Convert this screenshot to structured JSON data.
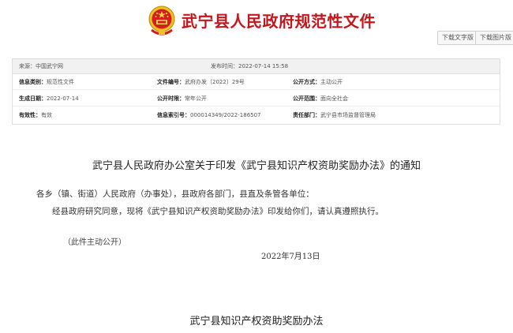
{
  "header": {
    "site_title": "武宁县人民政府规范性文件",
    "download_text": "下载文字版",
    "download_image": "下载图片版"
  },
  "meta": {
    "source_label": "来源：",
    "source_value": "中国武宁网",
    "publish_label": "发布时间：",
    "publish_value": "2022-07-14 15:58",
    "rows": [
      {
        "k1": "信息类别：",
        "v1": "规范性文件",
        "k2": "文件编号：",
        "v2": "武府办发〔2022〕29号",
        "k3": "公开方式：",
        "v3": "主动公开"
      },
      {
        "k1": "生成日期：",
        "v1": "2022-07-14",
        "k2": "公开时限：",
        "v2": "常年公开",
        "k3": "公开范围：",
        "v3": "面向全社会"
      },
      {
        "k1": "有效性：",
        "v1": "有效",
        "k2": "信息索引号：",
        "v2": "000014349/2022-186507",
        "k3": "责任部门：",
        "v3": "武宁县市场监督管理局"
      }
    ]
  },
  "document": {
    "title": "武宁县人民政府办公室关于印发《武宁县知识产权资助奖励办法》的通知",
    "salutation": "各乡（镇、街道）人民政府（办事处），县政府各部门，县直及条管各单位：",
    "body": "经县政府研究同意，现将《武宁县知识产权资助奖励办法》印发给你们，请认真遵照执行。",
    "note": "（此件主动公开）",
    "date": "2022年7月13日",
    "sub_title": "武宁县知识产权资助奖励办法"
  },
  "colors": {
    "title_red": "#c4161c",
    "emblem_gold": "#f0c020"
  },
  "icons": {
    "emblem": "national-emblem-icon"
  }
}
